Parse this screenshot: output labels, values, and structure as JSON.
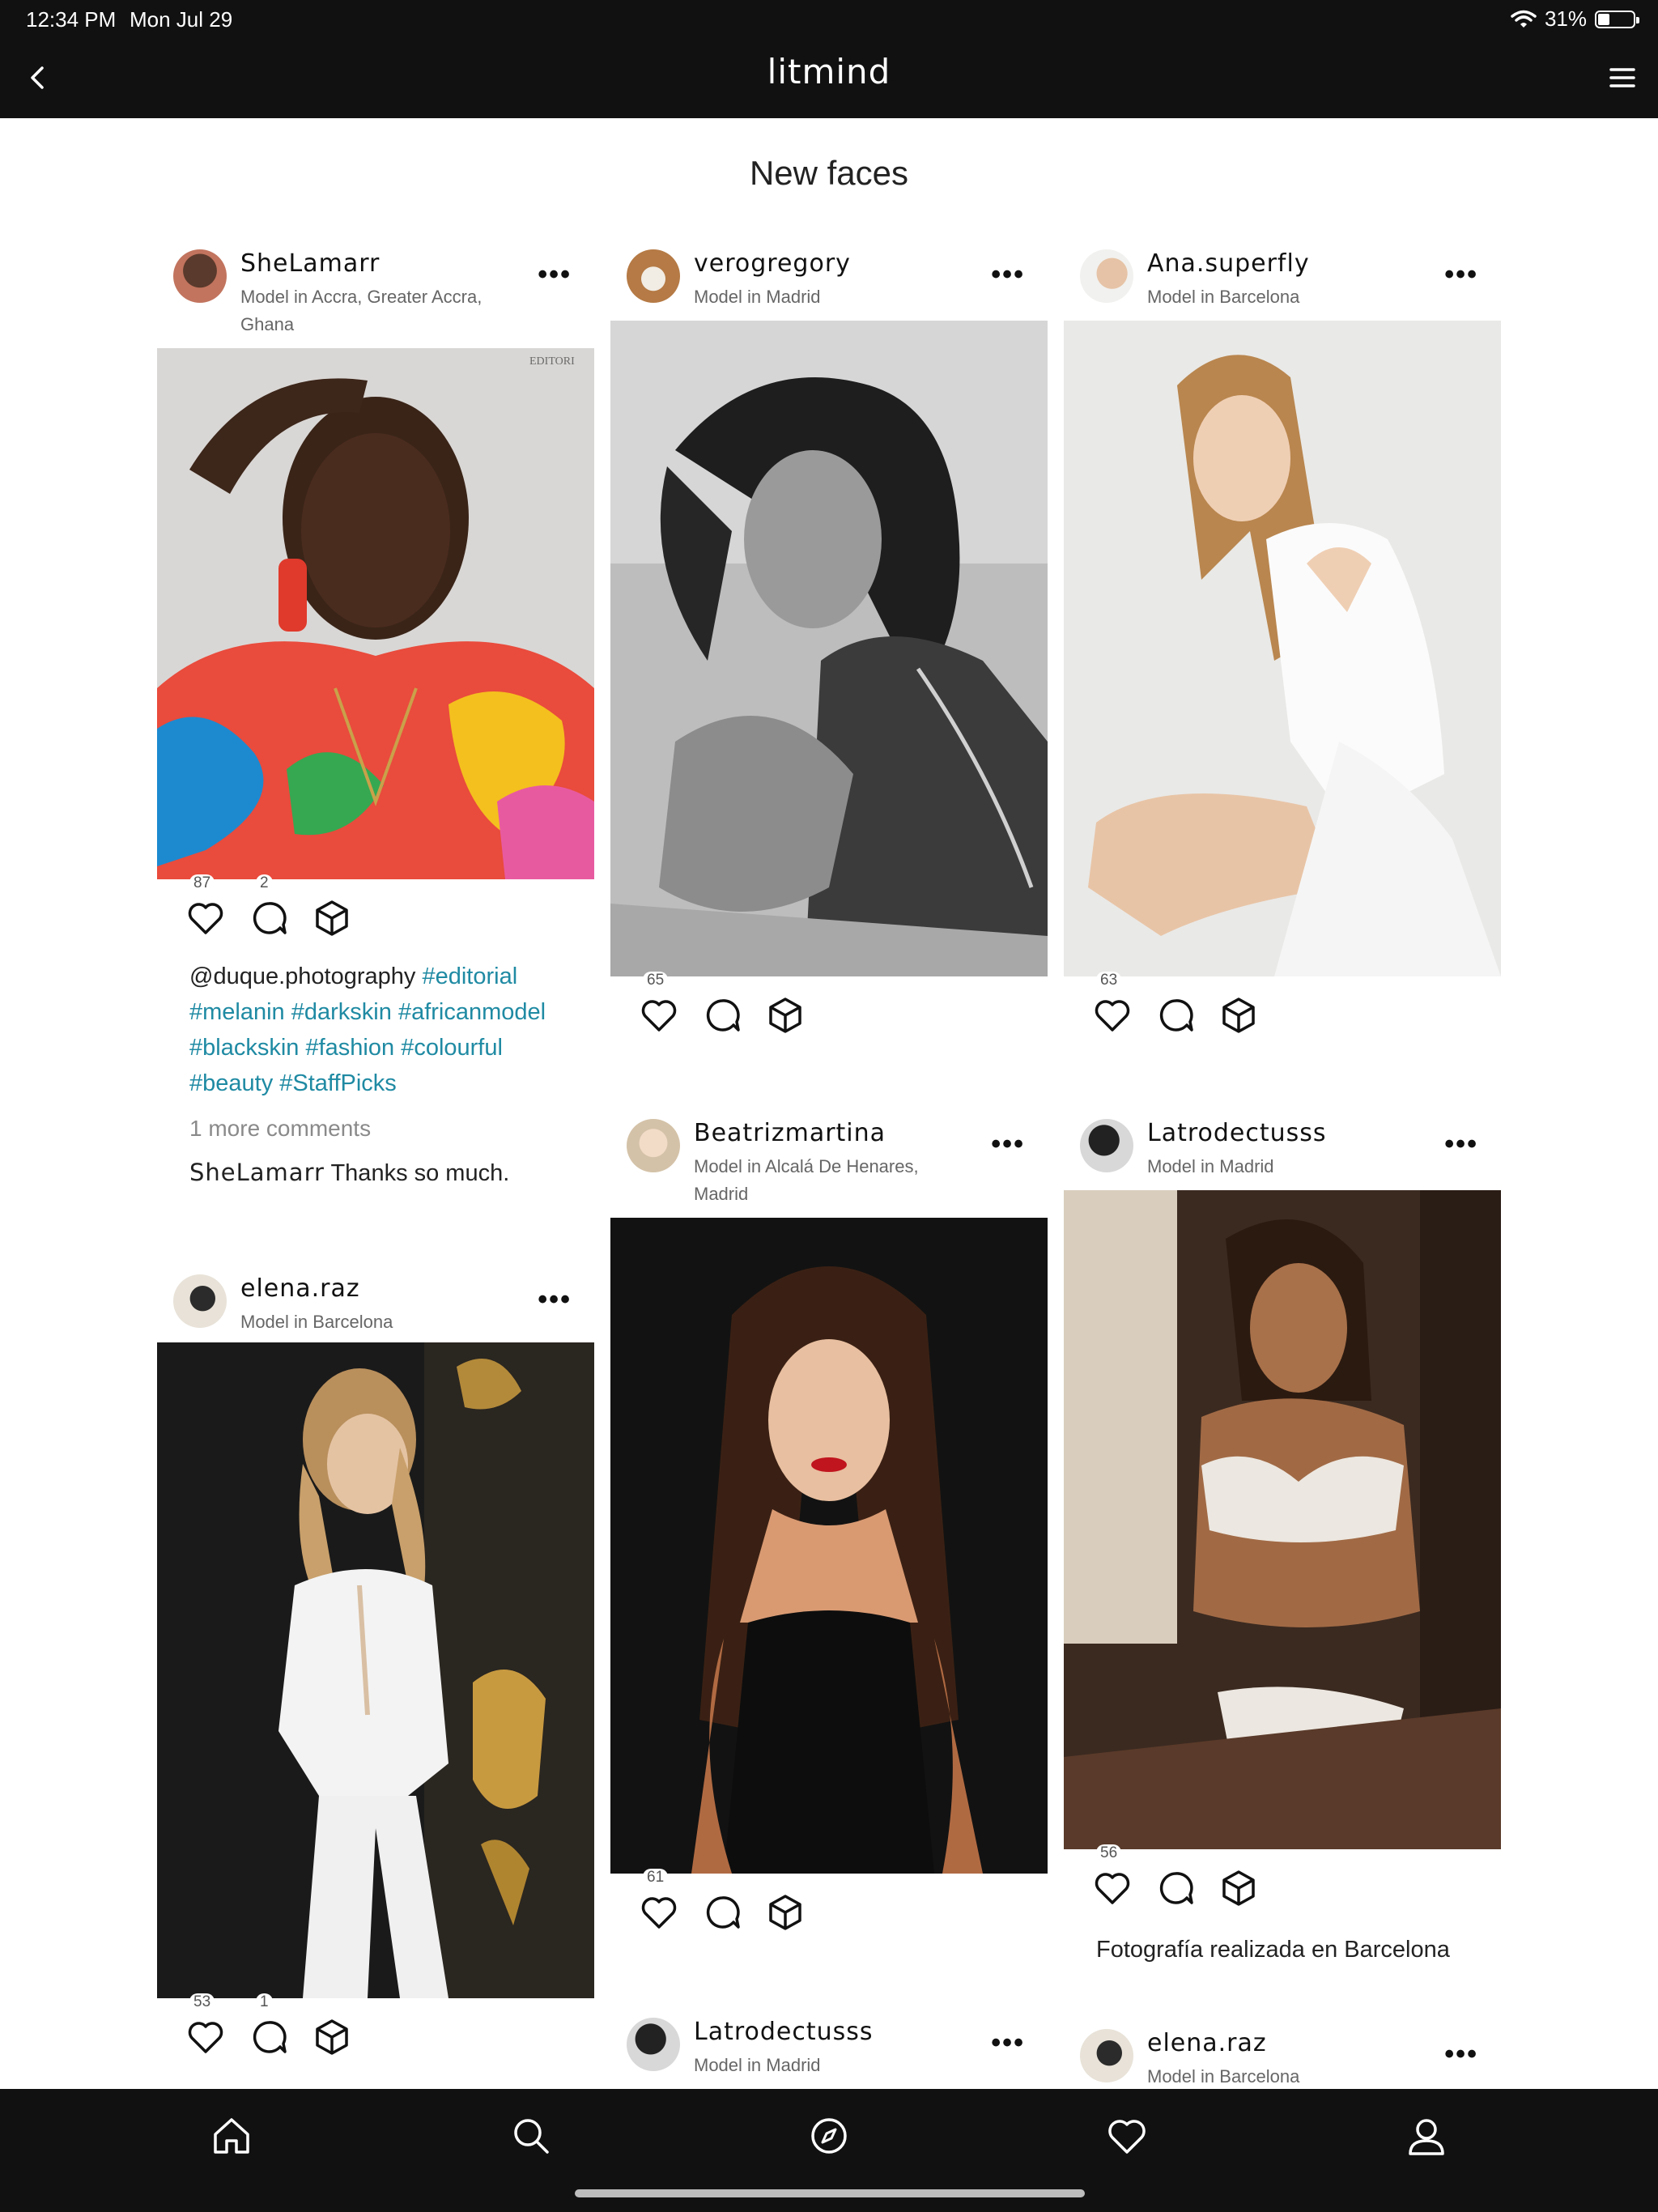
{
  "status": {
    "time": "12:34 PM",
    "date": "Mon Jul 29",
    "battery": "31%"
  },
  "app": {
    "logo": "litmind",
    "page_title": "New faces"
  },
  "colors": {
    "header_bg": "#111111",
    "hashtag": "#1f8aa3",
    "muted_text": "#8a8a8a"
  },
  "icons": [
    "chevron-left-icon",
    "menu-icon",
    "heart-icon",
    "comment-icon",
    "cube-icon",
    "home-icon",
    "search-icon",
    "compass-icon",
    "profile-icon",
    "wifi-icon",
    "battery-icon"
  ],
  "cards": {
    "shelamarr": {
      "username": "SheLamarr",
      "location": "Model in Accra, Greater Accra, Ghana",
      "likes": "87",
      "comments": "2",
      "caption_handle": "@duque.photography",
      "tags": [
        "#editorial",
        "#melanin",
        "#darkskin",
        "#africanmodel",
        "#blackskin",
        "#fashion",
        "#colourful",
        "#beauty",
        "#StaffPicks"
      ],
      "more_comments": "1 more comments",
      "reply_user": "SheLamarr",
      "reply_text": "Thanks so much.",
      "photo_label": "EDITORI"
    },
    "verogregory": {
      "username": "verogregory",
      "location": "Model in Madrid",
      "likes": "65"
    },
    "anasuperfly": {
      "username": "Ana.superfly",
      "location": "Model in Barcelona",
      "likes": "63"
    },
    "beatriz": {
      "username": "Beatrizmartina",
      "location": "Model in Alcalá De Henares, Madrid",
      "likes": "61"
    },
    "latro1": {
      "username": "Latrodectusss",
      "location": "Model in Madrid",
      "likes": "56",
      "caption": "Fotografía realizada en Barcelona"
    },
    "elena1": {
      "username": "elena.raz",
      "location": "Model in Barcelona",
      "likes": "53",
      "comments": "1"
    },
    "latro2": {
      "username": "Latrodectusss",
      "location": "Model in Madrid"
    },
    "elena2": {
      "username": "elena.raz",
      "location": "Model in Barcelona"
    }
  },
  "more_menu": "•••"
}
